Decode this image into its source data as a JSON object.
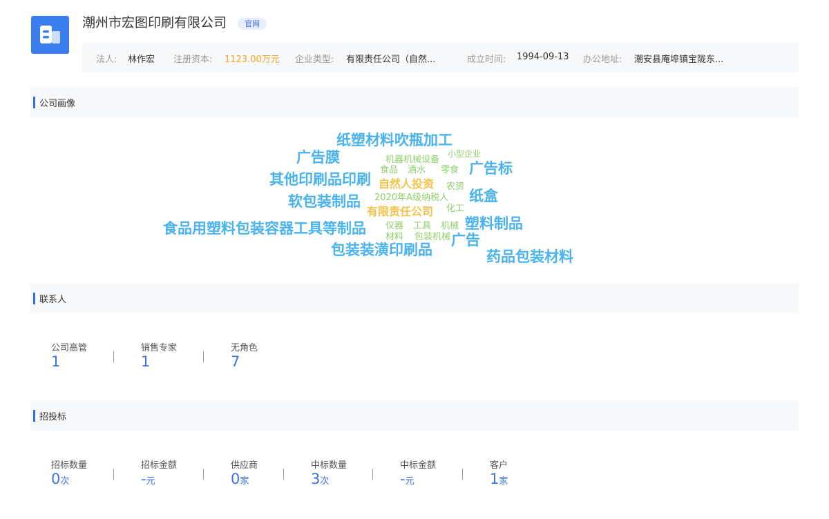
{
  "header": {
    "company_name": "潮州市宏图印刷有限公司",
    "official_badge": "官网",
    "logo_icon": "building-icon"
  },
  "info": {
    "legal_person_label": "法人:",
    "legal_person": "林作宏",
    "capital_label": "注册资本:",
    "capital": "1123.00万元",
    "type_label": "企业类型:",
    "type": "有限责任公司（自然...",
    "founded_label": "成立时间:",
    "founded": "1994-09-13",
    "address_label": "办公地址:",
    "address": "潮安县庵埠镇宝陇东..."
  },
  "portrait": {
    "title": "公司画像",
    "tags": [
      "纸塑材料吹瓶加工",
      "广告膜",
      "机器机械设备",
      "小型企业",
      "食品",
      "酒水",
      "零食",
      "广告标",
      "其他印刷品印刷",
      "自然人投资",
      "农资",
      "软包装制品",
      "2020年A级纳税人",
      "纸盒",
      "有限责任公司",
      "化工",
      "食品用塑料包装容器工具等制品",
      "仪器",
      "工具",
      "机械",
      "塑料制品",
      "材料",
      "包装机械",
      "广告",
      "包装装潢印刷品",
      "药品包装材料"
    ],
    "colors": {
      "blue": "#4ab3ef",
      "green": "#8fd06a",
      "orange": "#f5c24a"
    }
  },
  "contacts": {
    "title": "联系人",
    "stats": [
      {
        "label": "公司高管",
        "value": "1"
      },
      {
        "label": "销售专家",
        "value": "1"
      },
      {
        "label": "无角色",
        "value": "7"
      }
    ]
  },
  "bidding": {
    "title": "招投标",
    "stats": [
      {
        "label": "招标数量",
        "value": "0",
        "unit": "次"
      },
      {
        "label": "招标金额",
        "value": "-",
        "unit": "元"
      },
      {
        "label": "供应商",
        "value": "0",
        "unit": "家"
      },
      {
        "label": "中标数量",
        "value": "3",
        "unit": "次"
      },
      {
        "label": "中标金额",
        "value": "-",
        "unit": "元"
      },
      {
        "label": "客户",
        "value": "1",
        "unit": "家"
      }
    ]
  }
}
